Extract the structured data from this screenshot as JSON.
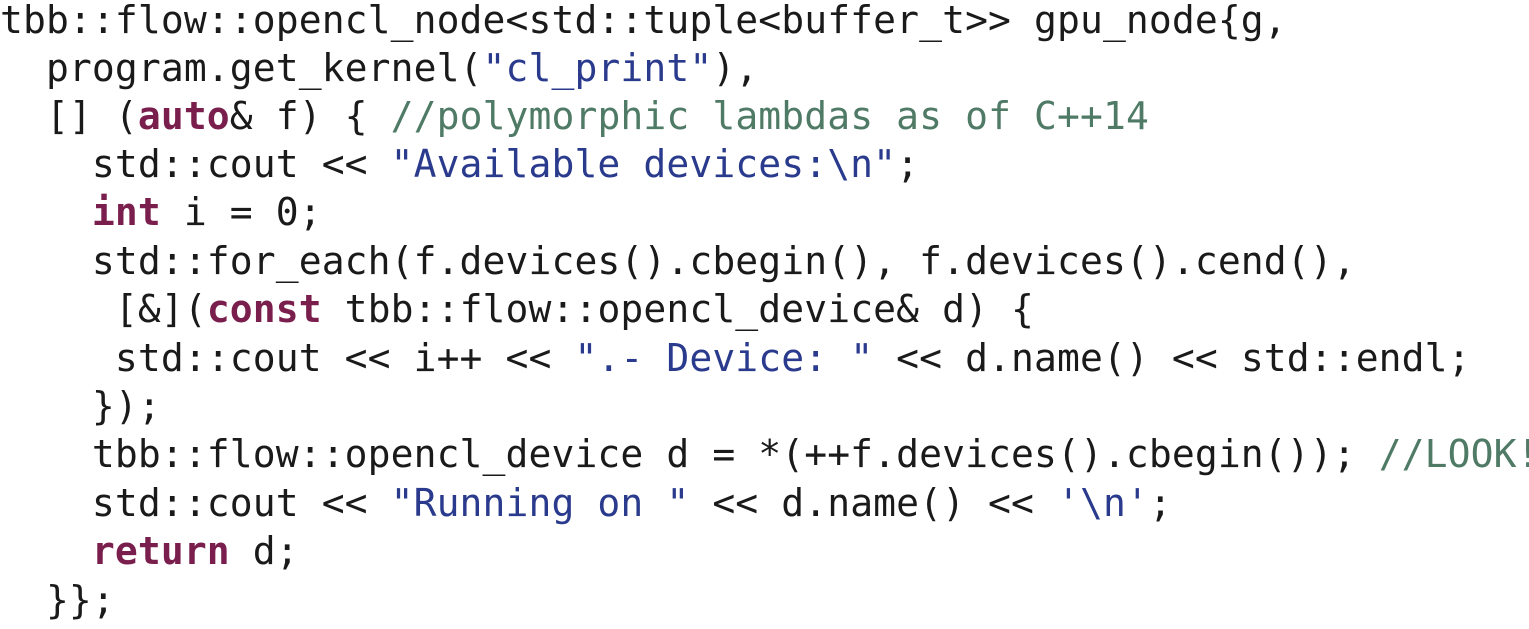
{
  "colors": {
    "plain": "#1a1a1a",
    "keyword": "#7a1f4d",
    "string": "#2a3a8c",
    "comment": "#4f7a66"
  },
  "code_lines": [
    [
      {
        "t": "plain",
        "v": "tbb::flow::opencl_node<std::tuple<buffer_t>> gpu_node{g,"
      }
    ],
    [
      {
        "t": "plain",
        "v": "  program.get_kernel("
      },
      {
        "t": "string",
        "v": "\"cl_print\""
      },
      {
        "t": "plain",
        "v": "),"
      }
    ],
    [
      {
        "t": "plain",
        "v": "  [] ("
      },
      {
        "t": "keyword",
        "v": "auto"
      },
      {
        "t": "plain",
        "v": "& f) { "
      },
      {
        "t": "comment",
        "v": "//polymorphic lambdas as of C++14"
      }
    ],
    [
      {
        "t": "plain",
        "v": "    std::cout << "
      },
      {
        "t": "string",
        "v": "\"Available devices:\\n\""
      },
      {
        "t": "plain",
        "v": ";"
      }
    ],
    [
      {
        "t": "plain",
        "v": "    "
      },
      {
        "t": "keyword",
        "v": "int"
      },
      {
        "t": "plain",
        "v": " i = 0;"
      }
    ],
    [
      {
        "t": "plain",
        "v": "    std::for_each(f.devices().cbegin(), f.devices().cend(),"
      }
    ],
    [
      {
        "t": "plain",
        "v": "     [&]("
      },
      {
        "t": "keyword",
        "v": "const"
      },
      {
        "t": "plain",
        "v": " tbb::flow::opencl_device& d) {"
      }
    ],
    [
      {
        "t": "plain",
        "v": "     std::cout << i++ << "
      },
      {
        "t": "string",
        "v": "\".- Device: \""
      },
      {
        "t": "plain",
        "v": " << d.name() << std::endl;"
      }
    ],
    [
      {
        "t": "plain",
        "v": "    });"
      }
    ],
    [
      {
        "t": "plain",
        "v": "    tbb::flow::opencl_device d = *(++f.devices().cbegin()); "
      },
      {
        "t": "comment",
        "v": "//LOOK!"
      }
    ],
    [
      {
        "t": "plain",
        "v": "    std::cout << "
      },
      {
        "t": "string",
        "v": "\"Running on \""
      },
      {
        "t": "plain",
        "v": " << d.name() << "
      },
      {
        "t": "string",
        "v": "'\\n'"
      },
      {
        "t": "plain",
        "v": ";"
      }
    ],
    [
      {
        "t": "plain",
        "v": "    "
      },
      {
        "t": "keyword",
        "v": "return"
      },
      {
        "t": "plain",
        "v": " d;"
      }
    ],
    [
      {
        "t": "plain",
        "v": "  }};"
      }
    ]
  ]
}
